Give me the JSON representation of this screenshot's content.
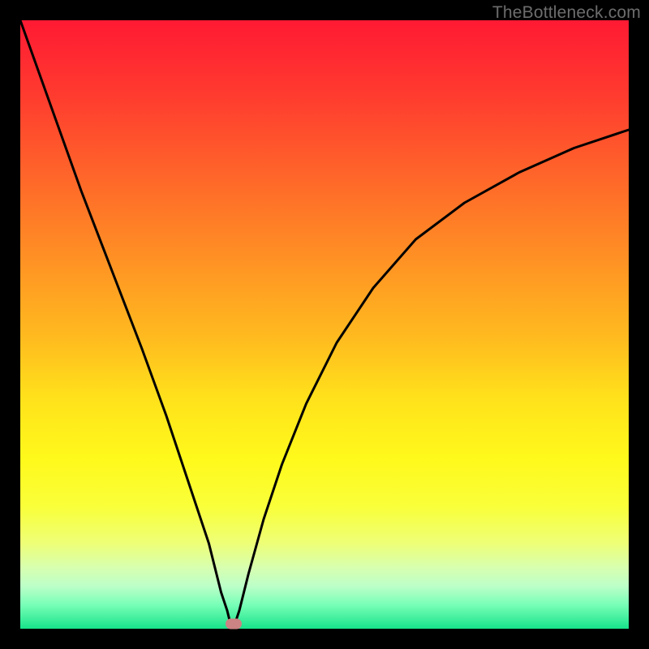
{
  "watermark": "TheBottleneck.com",
  "chart_data": {
    "type": "line",
    "title": "",
    "xlabel": "",
    "ylabel": "",
    "xlim": [
      0,
      100
    ],
    "ylim": [
      0,
      100
    ],
    "series": [
      {
        "name": "curve",
        "x": [
          0,
          5,
          10,
          15,
          20,
          24,
          27,
          29,
          31,
          32,
          33,
          34,
          34.5,
          35,
          36,
          37.5,
          40,
          43,
          47,
          52,
          58,
          65,
          73,
          82,
          91,
          100
        ],
        "values": [
          100,
          86,
          72,
          59,
          46,
          35,
          26,
          20,
          14,
          10,
          6,
          3,
          1,
          0,
          3,
          9,
          18,
          27,
          37,
          47,
          56,
          64,
          70,
          75,
          79,
          82
        ]
      }
    ],
    "marker": {
      "x": 35,
      "y": 0.8
    },
    "grid": false
  }
}
